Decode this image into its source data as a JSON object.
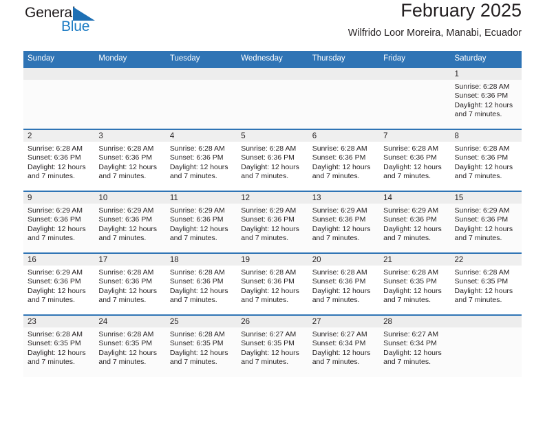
{
  "brand": {
    "name_top": "General",
    "name_bottom": "Blue",
    "logo_icon": "blue-triangle-flag-icon",
    "accent_color": "#1d7cc4"
  },
  "header": {
    "title": "February 2025",
    "subtitle": "Wilfrido Loor Moreira, Manabi, Ecuador"
  },
  "calendar": {
    "header_bg": "#2f74b5",
    "weekday_headers": [
      "Sunday",
      "Monday",
      "Tuesday",
      "Wednesday",
      "Thursday",
      "Friday",
      "Saturday"
    ],
    "labels": {
      "sunrise": "Sunrise:",
      "sunset": "Sunset:",
      "daylight": "Daylight:"
    },
    "weeks": [
      [
        {
          "day": "",
          "empty": true
        },
        {
          "day": "",
          "empty": true
        },
        {
          "day": "",
          "empty": true
        },
        {
          "day": "",
          "empty": true
        },
        {
          "day": "",
          "empty": true
        },
        {
          "day": "",
          "empty": true
        },
        {
          "day": "1",
          "sunrise": "Sunrise: 6:28 AM",
          "sunset": "Sunset: 6:36 PM",
          "daylight": "Daylight: 12 hours and 7 minutes."
        }
      ],
      [
        {
          "day": "2",
          "sunrise": "Sunrise: 6:28 AM",
          "sunset": "Sunset: 6:36 PM",
          "daylight": "Daylight: 12 hours and 7 minutes."
        },
        {
          "day": "3",
          "sunrise": "Sunrise: 6:28 AM",
          "sunset": "Sunset: 6:36 PM",
          "daylight": "Daylight: 12 hours and 7 minutes."
        },
        {
          "day": "4",
          "sunrise": "Sunrise: 6:28 AM",
          "sunset": "Sunset: 6:36 PM",
          "daylight": "Daylight: 12 hours and 7 minutes."
        },
        {
          "day": "5",
          "sunrise": "Sunrise: 6:28 AM",
          "sunset": "Sunset: 6:36 PM",
          "daylight": "Daylight: 12 hours and 7 minutes."
        },
        {
          "day": "6",
          "sunrise": "Sunrise: 6:28 AM",
          "sunset": "Sunset: 6:36 PM",
          "daylight": "Daylight: 12 hours and 7 minutes."
        },
        {
          "day": "7",
          "sunrise": "Sunrise: 6:28 AM",
          "sunset": "Sunset: 6:36 PM",
          "daylight": "Daylight: 12 hours and 7 minutes."
        },
        {
          "day": "8",
          "sunrise": "Sunrise: 6:28 AM",
          "sunset": "Sunset: 6:36 PM",
          "daylight": "Daylight: 12 hours and 7 minutes."
        }
      ],
      [
        {
          "day": "9",
          "sunrise": "Sunrise: 6:29 AM",
          "sunset": "Sunset: 6:36 PM",
          "daylight": "Daylight: 12 hours and 7 minutes."
        },
        {
          "day": "10",
          "sunrise": "Sunrise: 6:29 AM",
          "sunset": "Sunset: 6:36 PM",
          "daylight": "Daylight: 12 hours and 7 minutes."
        },
        {
          "day": "11",
          "sunrise": "Sunrise: 6:29 AM",
          "sunset": "Sunset: 6:36 PM",
          "daylight": "Daylight: 12 hours and 7 minutes."
        },
        {
          "day": "12",
          "sunrise": "Sunrise: 6:29 AM",
          "sunset": "Sunset: 6:36 PM",
          "daylight": "Daylight: 12 hours and 7 minutes."
        },
        {
          "day": "13",
          "sunrise": "Sunrise: 6:29 AM",
          "sunset": "Sunset: 6:36 PM",
          "daylight": "Daylight: 12 hours and 7 minutes."
        },
        {
          "day": "14",
          "sunrise": "Sunrise: 6:29 AM",
          "sunset": "Sunset: 6:36 PM",
          "daylight": "Daylight: 12 hours and 7 minutes."
        },
        {
          "day": "15",
          "sunrise": "Sunrise: 6:29 AM",
          "sunset": "Sunset: 6:36 PM",
          "daylight": "Daylight: 12 hours and 7 minutes."
        }
      ],
      [
        {
          "day": "16",
          "sunrise": "Sunrise: 6:29 AM",
          "sunset": "Sunset: 6:36 PM",
          "daylight": "Daylight: 12 hours and 7 minutes."
        },
        {
          "day": "17",
          "sunrise": "Sunrise: 6:28 AM",
          "sunset": "Sunset: 6:36 PM",
          "daylight": "Daylight: 12 hours and 7 minutes."
        },
        {
          "day": "18",
          "sunrise": "Sunrise: 6:28 AM",
          "sunset": "Sunset: 6:36 PM",
          "daylight": "Daylight: 12 hours and 7 minutes."
        },
        {
          "day": "19",
          "sunrise": "Sunrise: 6:28 AM",
          "sunset": "Sunset: 6:36 PM",
          "daylight": "Daylight: 12 hours and 7 minutes."
        },
        {
          "day": "20",
          "sunrise": "Sunrise: 6:28 AM",
          "sunset": "Sunset: 6:36 PM",
          "daylight": "Daylight: 12 hours and 7 minutes."
        },
        {
          "day": "21",
          "sunrise": "Sunrise: 6:28 AM",
          "sunset": "Sunset: 6:35 PM",
          "daylight": "Daylight: 12 hours and 7 minutes."
        },
        {
          "day": "22",
          "sunrise": "Sunrise: 6:28 AM",
          "sunset": "Sunset: 6:35 PM",
          "daylight": "Daylight: 12 hours and 7 minutes."
        }
      ],
      [
        {
          "day": "23",
          "sunrise": "Sunrise: 6:28 AM",
          "sunset": "Sunset: 6:35 PM",
          "daylight": "Daylight: 12 hours and 7 minutes."
        },
        {
          "day": "24",
          "sunrise": "Sunrise: 6:28 AM",
          "sunset": "Sunset: 6:35 PM",
          "daylight": "Daylight: 12 hours and 7 minutes."
        },
        {
          "day": "25",
          "sunrise": "Sunrise: 6:28 AM",
          "sunset": "Sunset: 6:35 PM",
          "daylight": "Daylight: 12 hours and 7 minutes."
        },
        {
          "day": "26",
          "sunrise": "Sunrise: 6:27 AM",
          "sunset": "Sunset: 6:35 PM",
          "daylight": "Daylight: 12 hours and 7 minutes."
        },
        {
          "day": "27",
          "sunrise": "Sunrise: 6:27 AM",
          "sunset": "Sunset: 6:34 PM",
          "daylight": "Daylight: 12 hours and 7 minutes."
        },
        {
          "day": "28",
          "sunrise": "Sunrise: 6:27 AM",
          "sunset": "Sunset: 6:34 PM",
          "daylight": "Daylight: 12 hours and 7 minutes."
        },
        {
          "day": "",
          "empty": true
        }
      ]
    ]
  }
}
